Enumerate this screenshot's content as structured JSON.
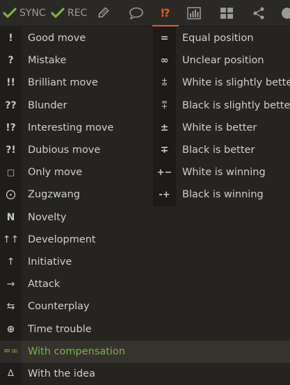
{
  "toolbar": {
    "sync_label": "SYNC",
    "rec_label": "REC",
    "annotation_glyph": "⁉",
    "accent_color": "#e75a1a",
    "check_color": "#7cb342",
    "icons": [
      "check-icon",
      "tag-icon",
      "comment-icon",
      "annotation-icon",
      "chart-icon",
      "grid-icon",
      "share-icon",
      "more-icon"
    ]
  },
  "move_annotations": [
    {
      "glyph": "!",
      "label": "Good move"
    },
    {
      "glyph": "?",
      "label": "Mistake"
    },
    {
      "glyph": "!!",
      "label": "Brilliant move"
    },
    {
      "glyph": "??",
      "label": "Blunder"
    },
    {
      "glyph": "!?",
      "label": "Interesting move"
    },
    {
      "glyph": "?!",
      "label": "Dubious move"
    },
    {
      "glyph": "□",
      "label": "Only move"
    },
    {
      "glyph": "⨀",
      "label": "Zugzwang"
    },
    {
      "glyph": "N",
      "label": "Novelty"
    },
    {
      "glyph": "↑↑",
      "label": "Development"
    },
    {
      "glyph": "↑",
      "label": "Initiative"
    },
    {
      "glyph": "→",
      "label": "Attack"
    },
    {
      "glyph": "⇆",
      "label": "Counterplay"
    },
    {
      "glyph": "⊕",
      "label": "Time trouble"
    },
    {
      "glyph": "=∞",
      "label": "With compensation",
      "highlight_color": "#7cb342"
    },
    {
      "glyph": "∆",
      "label": "With the idea"
    }
  ],
  "position_annotations": [
    {
      "glyph": "=",
      "label": "Equal position"
    },
    {
      "glyph": "∞",
      "label": "Unclear position"
    },
    {
      "glyph": "⩲",
      "label": "White is slightly better"
    },
    {
      "glyph": "⩱",
      "label": "Black is slightly better"
    },
    {
      "glyph": "±",
      "label": "White is better"
    },
    {
      "glyph": "∓",
      "label": "Black is better"
    },
    {
      "glyph": "+−",
      "label": "White is winning"
    },
    {
      "glyph": "-+",
      "label": "Black is winning"
    }
  ]
}
